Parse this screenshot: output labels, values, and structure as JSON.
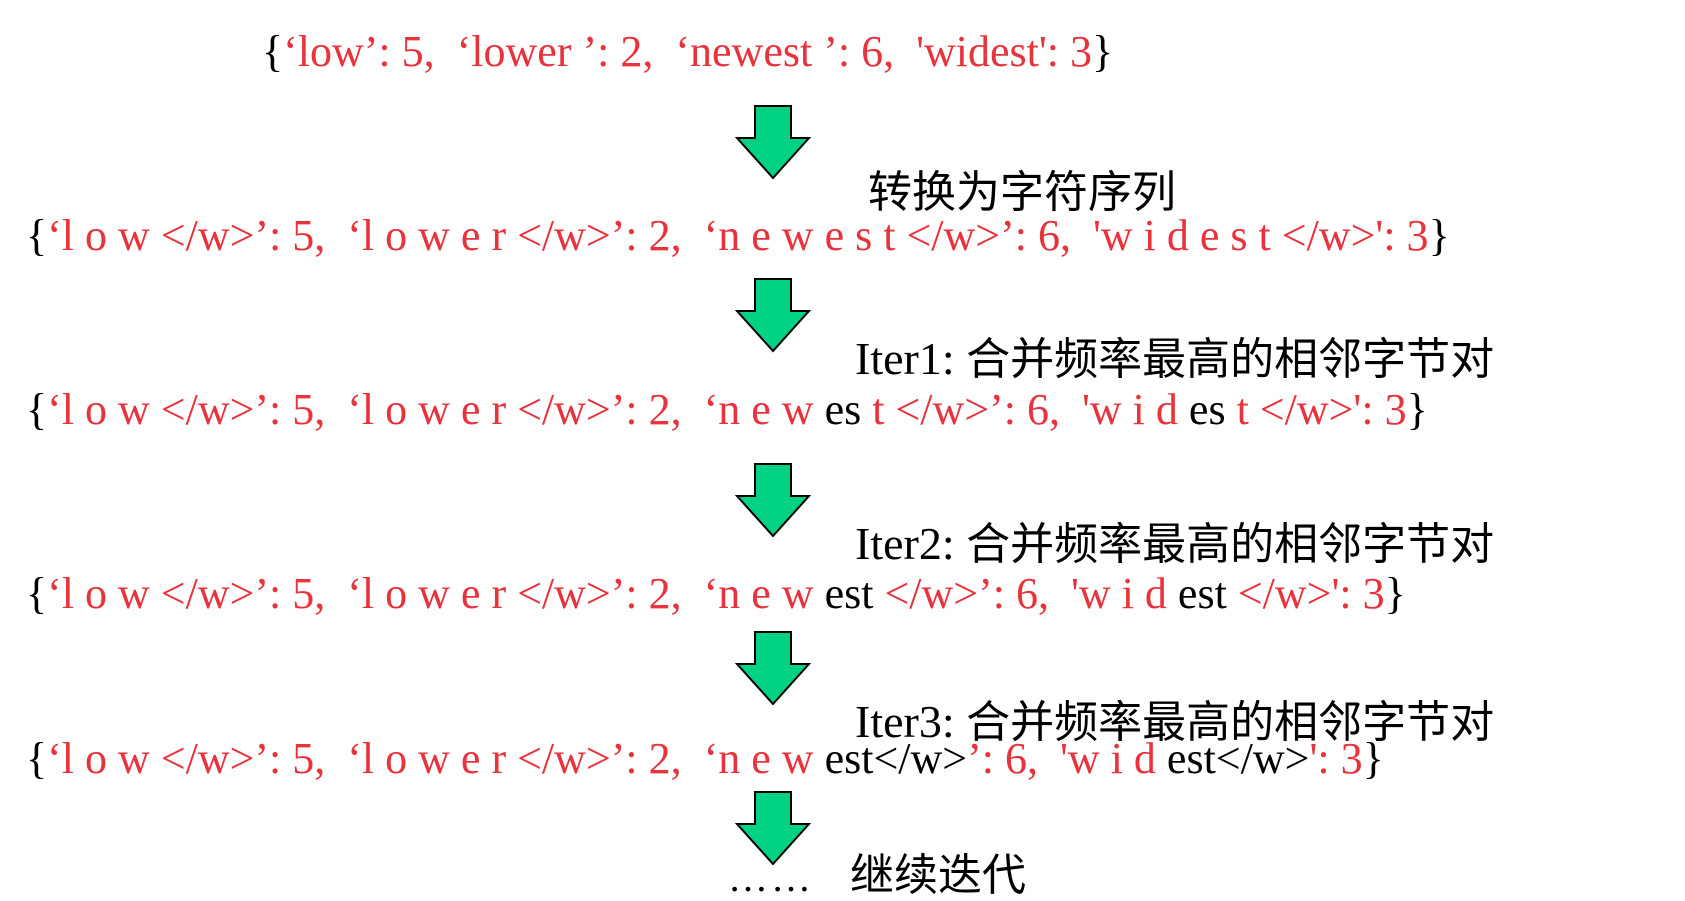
{
  "colors": {
    "red": "#e8323c",
    "black": "#000000",
    "arrow_fill": "#00d183",
    "arrow_stroke": "#000000"
  },
  "lines": [
    {
      "segments": [
        {
          "text": "{",
          "color": "black"
        },
        {
          "text": "‘low’: 5,  ‘lower ’: 2,  ‘newest ’: 6,  'widest': 3",
          "color": "red"
        },
        {
          "text": "}",
          "color": "black"
        }
      ]
    },
    {
      "segments": [
        {
          "text": "{",
          "color": "black"
        },
        {
          "text": "‘l o w </w>’: 5,  ‘l o w e r </w>’: 2,  ‘n e w e s t </w>’: 6,  'w i d e s t </w>': 3",
          "color": "red"
        },
        {
          "text": "}",
          "color": "black"
        }
      ]
    },
    {
      "segments": [
        {
          "text": "{",
          "color": "black"
        },
        {
          "text": "‘l o w </w>’: 5,  ‘l o w e r </w>’: 2,  ‘n e w ",
          "color": "red"
        },
        {
          "text": "es",
          "color": "black"
        },
        {
          "text": " t </w>’: 6,  'w i d ",
          "color": "red"
        },
        {
          "text": "es",
          "color": "black"
        },
        {
          "text": " t </w>': 3",
          "color": "red"
        },
        {
          "text": "}",
          "color": "black"
        }
      ]
    },
    {
      "segments": [
        {
          "text": "{",
          "color": "black"
        },
        {
          "text": "‘l o w </w>’: 5,  ‘l o w e r </w>’: 2,  ‘n e w ",
          "color": "red"
        },
        {
          "text": "est",
          "color": "black"
        },
        {
          "text": " </w>’: 6,  'w i d ",
          "color": "red"
        },
        {
          "text": "est",
          "color": "black"
        },
        {
          "text": " </w>': 3",
          "color": "red"
        },
        {
          "text": "}",
          "color": "black"
        }
      ]
    },
    {
      "segments": [
        {
          "text": "{",
          "color": "black"
        },
        {
          "text": "‘l o w </w>’: 5,  ‘l o w e r </w>’: 2,  ‘n e w ",
          "color": "red"
        },
        {
          "text": "est</w>",
          "color": "black"
        },
        {
          "text": "’: 6,  'w i d ",
          "color": "red"
        },
        {
          "text": "est</w>",
          "color": "black"
        },
        {
          "text": "': 3",
          "color": "red"
        },
        {
          "text": "}",
          "color": "black"
        }
      ]
    }
  ],
  "steps": [
    {
      "prefix": "",
      "text": "转换为字符序列"
    },
    {
      "prefix": "Iter1: ",
      "text": "合并频率最高的相邻字节对"
    },
    {
      "prefix": "Iter2: ",
      "text": "合并频率最高的相邻字节对"
    },
    {
      "prefix": "Iter3: ",
      "text": "合并频率最高的相邻字节对"
    },
    {
      "prefix": "",
      "text": "继续迭代"
    }
  ],
  "ellipsis": "……"
}
